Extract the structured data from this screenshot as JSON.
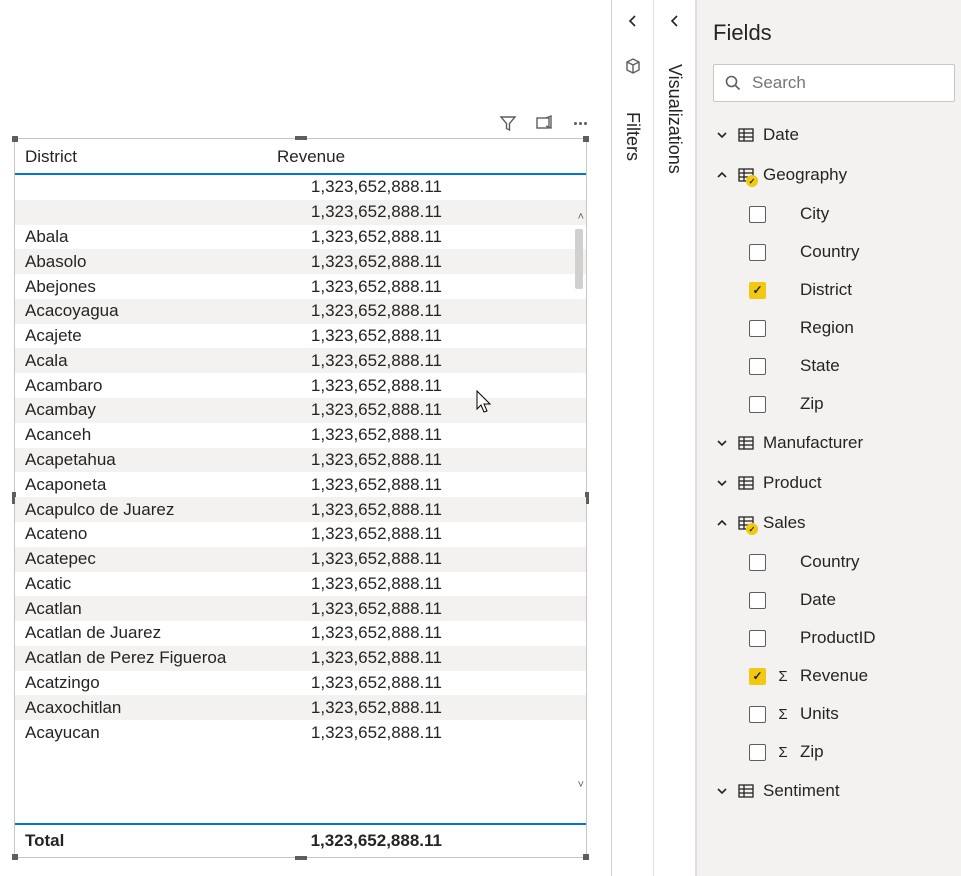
{
  "visual": {
    "header": {
      "col1": "District",
      "col2": "Revenue"
    },
    "rows": [
      {
        "district": "",
        "revenue": "1,323,652,888.11"
      },
      {
        "district": "",
        "revenue": "1,323,652,888.11"
      },
      {
        "district": "Abala",
        "revenue": "1,323,652,888.11"
      },
      {
        "district": "Abasolo",
        "revenue": "1,323,652,888.11"
      },
      {
        "district": "Abejones",
        "revenue": "1,323,652,888.11"
      },
      {
        "district": "Acacoyagua",
        "revenue": "1,323,652,888.11"
      },
      {
        "district": "Acajete",
        "revenue": "1,323,652,888.11"
      },
      {
        "district": "Acala",
        "revenue": "1,323,652,888.11"
      },
      {
        "district": "Acambaro",
        "revenue": "1,323,652,888.11"
      },
      {
        "district": "Acambay",
        "revenue": "1,323,652,888.11"
      },
      {
        "district": "Acanceh",
        "revenue": "1,323,652,888.11"
      },
      {
        "district": "Acapetahua",
        "revenue": "1,323,652,888.11"
      },
      {
        "district": "Acaponeta",
        "revenue": "1,323,652,888.11"
      },
      {
        "district": "Acapulco de Juarez",
        "revenue": "1,323,652,888.11"
      },
      {
        "district": "Acateno",
        "revenue": "1,323,652,888.11"
      },
      {
        "district": "Acatepec",
        "revenue": "1,323,652,888.11"
      },
      {
        "district": "Acatic",
        "revenue": "1,323,652,888.11"
      },
      {
        "district": "Acatlan",
        "revenue": "1,323,652,888.11"
      },
      {
        "district": "Acatlan de Juarez",
        "revenue": "1,323,652,888.11"
      },
      {
        "district": "Acatlan de Perez Figueroa",
        "revenue": "1,323,652,888.11"
      },
      {
        "district": "Acatzingo",
        "revenue": "1,323,652,888.11"
      },
      {
        "district": "Acaxochitlan",
        "revenue": "1,323,652,888.11"
      },
      {
        "district": "Acayucan",
        "revenue": "1,323,652,888.11"
      }
    ],
    "total": {
      "label": "Total",
      "value": "1,323,652,888.11"
    }
  },
  "rails": {
    "filters": "Filters",
    "visualizations": "Visualizations"
  },
  "fields": {
    "title": "Fields",
    "search_placeholder": "Search",
    "tables": [
      {
        "name": "Date",
        "expanded": false,
        "active": false,
        "fields": []
      },
      {
        "name": "Geography",
        "expanded": true,
        "active": true,
        "fields": [
          {
            "label": "City",
            "checked": false,
            "sigma": false
          },
          {
            "label": "Country",
            "checked": false,
            "sigma": false
          },
          {
            "label": "District",
            "checked": true,
            "sigma": false
          },
          {
            "label": "Region",
            "checked": false,
            "sigma": false
          },
          {
            "label": "State",
            "checked": false,
            "sigma": false
          },
          {
            "label": "Zip",
            "checked": false,
            "sigma": false
          }
        ]
      },
      {
        "name": "Manufacturer",
        "expanded": false,
        "active": false,
        "fields": []
      },
      {
        "name": "Product",
        "expanded": false,
        "active": false,
        "fields": []
      },
      {
        "name": "Sales",
        "expanded": true,
        "active": true,
        "fields": [
          {
            "label": "Country",
            "checked": false,
            "sigma": false
          },
          {
            "label": "Date",
            "checked": false,
            "sigma": false
          },
          {
            "label": "ProductID",
            "checked": false,
            "sigma": false
          },
          {
            "label": "Revenue",
            "checked": true,
            "sigma": true
          },
          {
            "label": "Units",
            "checked": false,
            "sigma": true
          },
          {
            "label": "Zip",
            "checked": false,
            "sigma": true
          }
        ]
      },
      {
        "name": "Sentiment",
        "expanded": false,
        "active": false,
        "fields": []
      }
    ]
  }
}
